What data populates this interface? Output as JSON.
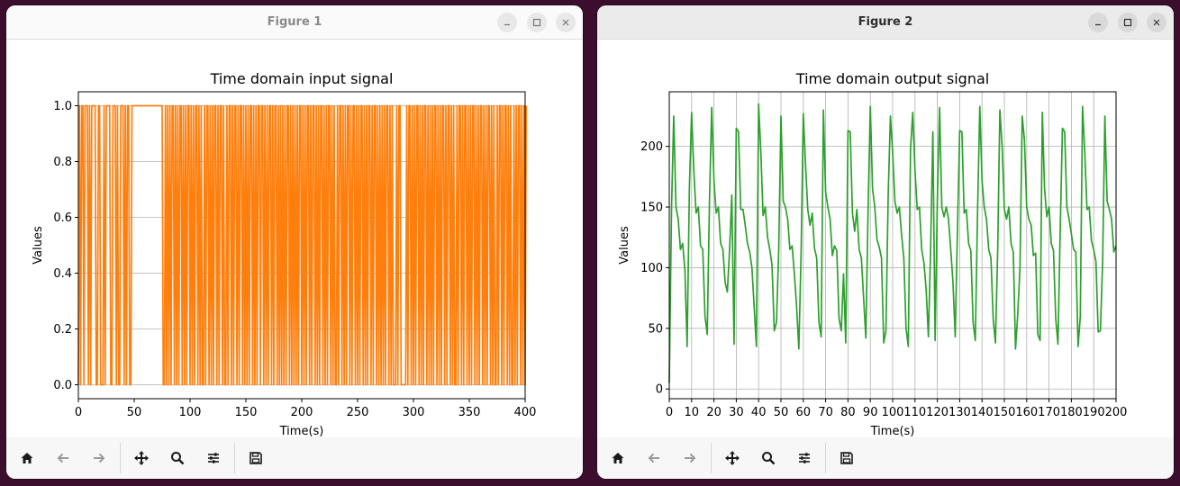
{
  "windows": [
    {
      "title": "Figure 1",
      "toolbar_icons": [
        "home-icon",
        "back-arrow-icon",
        "forward-arrow-icon",
        "pan-move-icon",
        "zoom-magnifier-icon",
        "configure-subplots-icon",
        "save-disk-icon"
      ]
    },
    {
      "title": "Figure 2",
      "toolbar_icons": [
        "home-icon",
        "back-arrow-icon",
        "forward-arrow-icon",
        "pan-move-icon",
        "zoom-magnifier-icon",
        "configure-subplots-icon",
        "save-disk-icon"
      ]
    }
  ],
  "chart_data": [
    {
      "type": "line",
      "title": "Time domain input signal",
      "xlabel": "Time(s)",
      "ylabel": "Values",
      "xlim": [
        0,
        400
      ],
      "ylim": [
        -0.05,
        1.05
      ],
      "xticks": [
        "0",
        "50",
        "100",
        "150",
        "200",
        "250",
        "300",
        "350",
        "400"
      ],
      "yticks": [
        "0.0",
        "0.2",
        "0.4",
        "0.6",
        "0.8",
        "1.0"
      ],
      "grid": "horizontal",
      "color": "#ff7f0e",
      "series": [
        {
          "x_start": 0,
          "x_step": 1,
          "values": [
            0,
            1,
            0,
            1,
            1,
            0,
            1,
            1,
            1,
            0,
            1,
            0,
            1,
            1,
            1,
            1,
            0,
            0,
            1,
            1,
            0,
            0,
            0,
            1,
            0,
            1,
            1,
            1,
            1,
            0,
            0,
            1,
            1,
            1,
            0,
            1,
            0,
            0,
            1,
            1,
            1,
            0,
            1,
            0,
            1,
            1,
            0,
            0,
            1,
            1,
            1,
            1,
            1,
            1,
            1,
            1,
            1,
            1,
            1,
            1,
            1,
            1,
            1,
            1,
            1,
            1,
            1,
            1,
            1,
            1,
            1,
            1,
            1,
            1,
            1,
            1,
            0,
            0,
            1,
            0,
            1,
            0,
            1,
            0,
            1,
            1,
            0,
            1,
            0,
            1,
            0,
            1,
            1,
            0,
            1,
            0,
            1,
            0,
            1,
            1,
            0,
            1,
            0,
            1,
            0,
            1,
            1,
            0,
            1,
            0,
            1,
            0,
            0,
            1,
            0,
            1,
            1,
            0,
            1,
            0,
            1,
            0,
            1,
            1,
            0,
            1,
            0,
            1,
            1,
            0,
            1,
            0,
            0,
            1,
            0,
            1,
            1,
            0,
            1,
            0,
            1,
            1,
            0,
            1,
            0,
            1,
            1,
            0,
            1,
            0,
            1,
            0,
            1,
            0,
            1,
            1,
            0,
            1,
            0,
            1,
            0,
            1,
            1,
            0,
            1,
            1,
            0,
            1,
            0,
            1,
            0,
            1,
            1,
            0,
            1,
            0,
            1,
            1,
            0,
            1,
            0,
            1,
            0,
            1,
            0,
            1,
            0,
            1,
            1,
            0,
            1,
            0,
            1,
            0,
            1,
            0,
            1,
            0,
            1,
            1,
            0,
            1,
            0,
            1,
            0,
            1,
            1,
            0,
            1,
            0,
            1,
            1,
            0,
            1,
            0,
            1,
            0,
            1,
            1,
            0,
            1,
            0,
            1,
            0,
            1,
            1,
            0,
            1,
            0,
            1,
            0,
            0,
            1,
            0,
            1,
            1,
            0,
            1,
            0,
            1,
            0,
            1,
            1,
            0,
            1,
            0,
            1,
            1,
            0,
            1,
            0,
            1,
            0,
            1,
            1,
            0,
            1,
            0,
            1,
            0,
            1,
            1,
            0,
            1,
            0,
            1,
            1,
            0,
            1,
            0,
            1,
            0,
            1,
            0,
            1,
            0,
            1,
            1,
            0,
            1,
            0,
            1,
            0,
            0,
            0,
            1,
            0,
            1,
            1,
            0,
            0,
            0,
            0,
            0,
            1,
            0,
            1,
            1,
            0,
            1,
            0,
            1,
            0,
            1,
            1,
            0,
            1,
            0,
            1,
            0,
            1,
            1,
            0,
            1,
            0,
            1,
            0,
            1,
            0,
            1,
            1,
            0,
            1,
            0,
            1,
            0,
            1,
            1,
            0,
            1,
            0,
            1,
            1,
            0,
            1,
            0,
            1,
            0,
            0,
            1,
            0,
            1,
            1,
            0,
            1,
            0,
            1,
            1,
            0,
            1,
            0,
            1,
            0,
            1,
            1,
            0,
            1,
            0,
            1,
            0,
            1,
            1,
            0,
            1,
            0,
            1,
            0,
            1,
            1,
            0,
            1,
            0,
            1,
            0,
            0,
            1,
            0,
            1,
            1,
            0,
            1,
            0,
            1,
            1,
            0,
            1,
            0,
            1,
            0,
            0,
            1,
            0,
            1,
            0,
            1,
            1,
            0,
            1,
            0,
            1,
            0,
            1
          ]
        }
      ]
    },
    {
      "type": "line",
      "title": "Time domain output signal",
      "xlabel": "Time(s)",
      "ylabel": "Values",
      "xlim": [
        0,
        200
      ],
      "ylim": [
        -8,
        245
      ],
      "xticks": [
        "0",
        "10",
        "20",
        "30",
        "40",
        "50",
        "60",
        "70",
        "80",
        "90",
        "100",
        "110",
        "120",
        "130",
        "140",
        "150",
        "160",
        "170",
        "180",
        "190",
        "200"
      ],
      "yticks": [
        "0",
        "50",
        "100",
        "150",
        "200"
      ],
      "grid": "both",
      "color": "#2ca02c",
      "series": [
        {
          "x_start": 0,
          "x_step": 1,
          "values": [
            5,
            148,
            225,
            150,
            140,
            115,
            120,
            98,
            35,
            165,
            228,
            180,
            145,
            150,
            118,
            115,
            60,
            45,
            155,
            232,
            172,
            145,
            150,
            120,
            115,
            88,
            80,
            115,
            160,
            37,
            215,
            212,
            148,
            148,
            135,
            120,
            113,
            100,
            68,
            35,
            235,
            195,
            143,
            150,
            125,
            115,
            102,
            48,
            55,
            115,
            225,
            155,
            150,
            140,
            115,
            118,
            95,
            68,
            33,
            110,
            227,
            185,
            148,
            135,
            145,
            116,
            108,
            55,
            43,
            230,
            162,
            150,
            140,
            110,
            118,
            114,
            58,
            48,
            95,
            38,
            213,
            212,
            145,
            130,
            148,
            115,
            108,
            75,
            42,
            148,
            233,
            165,
            150,
            123,
            117,
            108,
            38,
            48,
            160,
            225,
            195,
            155,
            145,
            150,
            127,
            108,
            50,
            35,
            198,
            228,
            180,
            148,
            150,
            115,
            104,
            82,
            43,
            115,
            212,
            40,
            155,
            232,
            150,
            142,
            150,
            140,
            115,
            88,
            43,
            130,
            213,
            212,
            145,
            148,
            120,
            114,
            55,
            40,
            145,
            233,
            172,
            150,
            140,
            115,
            108,
            58,
            38,
            112,
            230,
            200,
            148,
            140,
            150,
            120,
            113,
            33,
            62,
            100,
            225,
            205,
            150,
            140,
            135,
            110,
            112,
            45,
            40,
            228,
            165,
            142,
            150,
            120,
            114,
            58,
            37,
            130,
            215,
            212,
            150,
            140,
            128,
            115,
            113,
            35,
            60,
            233,
            195,
            148,
            150,
            122,
            115,
            105,
            47,
            48,
            105,
            225,
            155,
            148,
            140,
            113,
            118
          ]
        }
      ]
    }
  ]
}
